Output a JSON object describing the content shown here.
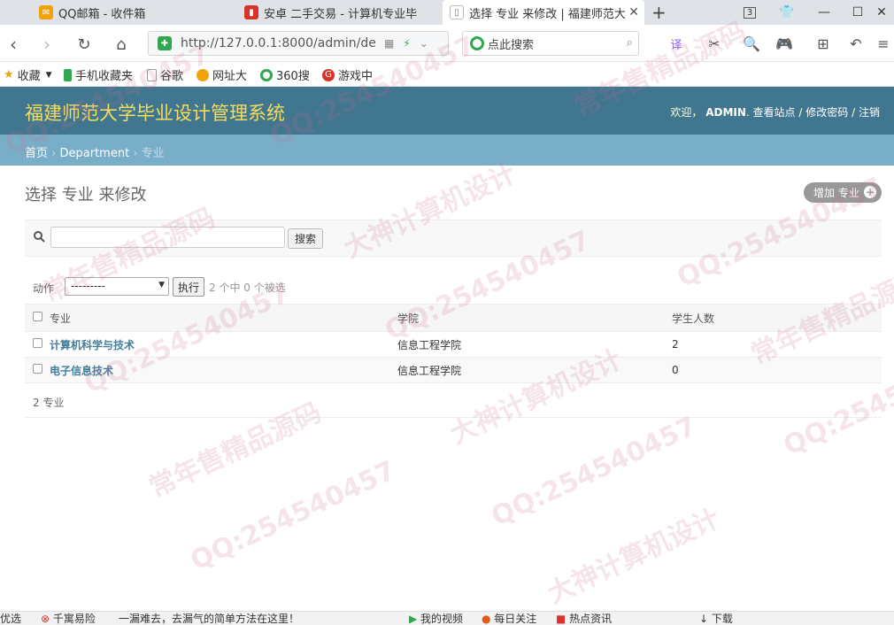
{
  "browser": {
    "tabs": [
      {
        "label": "QQ邮箱 - 收件箱",
        "icon": "qq-mail-icon",
        "active": false
      },
      {
        "label": "安卓 二手交易 - 计算机专业毕",
        "icon": "bookmark-red-icon",
        "active": false
      },
      {
        "label": "选择 专业 来修改 | 福建师范大",
        "icon": "page-icon",
        "active": true
      }
    ],
    "new_tab": "+",
    "tab_counter": "3",
    "window_controls": {
      "minimize": "—",
      "maximize": "☐",
      "close": "✕"
    },
    "url": "http://127.0.0.1:8000/admin/dep",
    "search_placeholder": "点此搜索",
    "bookmarks": [
      {
        "label": "收藏",
        "icon": "star-icon",
        "color": "#f0a30a"
      },
      {
        "label": "手机收藏夹",
        "icon": "phone-icon",
        "color": "#2fa84f"
      },
      {
        "label": "谷歌",
        "icon": "page-icon",
        "color": "#9aa0a6"
      },
      {
        "label": "网址大",
        "icon": "globe-icon",
        "color": "#f0a30a"
      },
      {
        "label": "360搜",
        "icon": "search-360-icon",
        "color": "#2fa84f"
      },
      {
        "label": "游戏中",
        "icon": "game-icon",
        "color": "#d9342b"
      }
    ]
  },
  "admin": {
    "site_title": "福建师范大学毕业设计管理系统",
    "user_tools": {
      "welcome": "欢迎，",
      "username": "ADMIN",
      "view_site": "查看站点",
      "change_password": "修改密码",
      "logout": "注销",
      "sep": "/"
    },
    "breadcrumbs": {
      "home": "首页",
      "app": "Department",
      "current": "专业",
      "sep": "›"
    },
    "content_title": "选择 专业 来修改",
    "add_button": "增加 专业",
    "search_button": "搜索",
    "actions": {
      "label": "动作",
      "selected_option": "---------",
      "go": "执行",
      "counter": "2 个中 0 个被选"
    },
    "table": {
      "columns": [
        "专业",
        "学院",
        "学生人数"
      ],
      "rows": [
        {
          "name": "计算机科学与技术",
          "college": "信息工程学院",
          "students": "2"
        },
        {
          "name": "电子信息技术",
          "college": "信息工程学院",
          "students": "0"
        }
      ]
    },
    "paginator": "2 专业"
  },
  "statusbar": {
    "left": [
      "优选",
      "千寓易险",
      "一漏难去，去漏气的简单方法在这里！"
    ],
    "right": [
      "我的视频",
      "每日关注",
      "热点资讯",
      "下载"
    ]
  },
  "watermarks": [
    "QQ:254540457",
    "常年售精品源码",
    "大神计算机设计"
  ],
  "colors": {
    "header": "#417690",
    "breadcrumbs": "#79aec8",
    "site_title": "#f5dd5d",
    "link": "#447e9b"
  }
}
